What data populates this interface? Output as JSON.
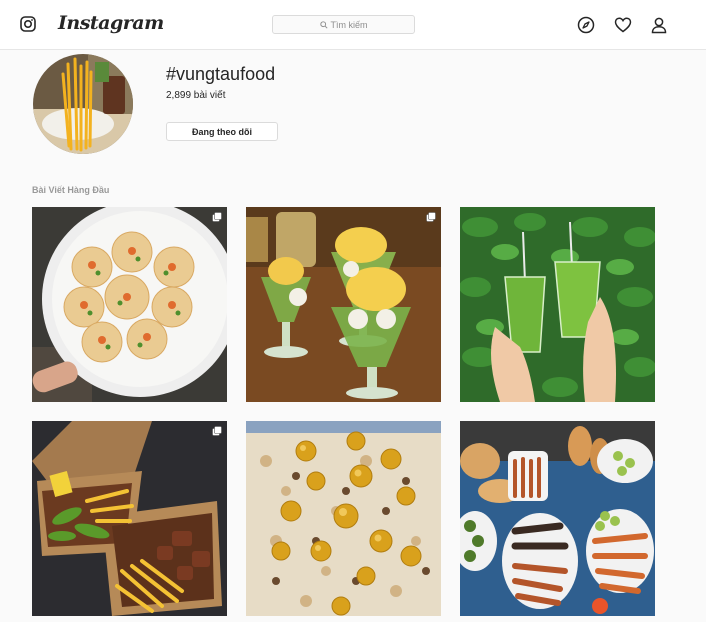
{
  "header": {
    "brand": "Instagram",
    "search_placeholder": "Tìm kiếm",
    "icons": [
      "instagram-logo-icon",
      "explore-compass-icon",
      "heart-icon",
      "profile-icon"
    ]
  },
  "profile": {
    "hashtag": "#vungtaufood",
    "post_count": "2,899 bài viết",
    "follow_label": "Đang theo dõi"
  },
  "top_posts": {
    "title": "Bài Viết Hàng Đầu",
    "posts": [
      {
        "name": "post-shrimp-pancakes",
        "multi": true
      },
      {
        "name": "post-avocado-ice-cream",
        "multi": true
      },
      {
        "name": "post-green-drinks",
        "multi": false
      },
      {
        "name": "post-steak-fries-box",
        "multi": true
      },
      {
        "name": "post-sticky-rice-quail-eggs",
        "multi": false
      },
      {
        "name": "post-grilled-skewers-table",
        "multi": false
      }
    ]
  },
  "colors": {
    "border": "#dbdbdb",
    "background": "#fafafa",
    "text": "#262626",
    "muted": "#999999"
  }
}
